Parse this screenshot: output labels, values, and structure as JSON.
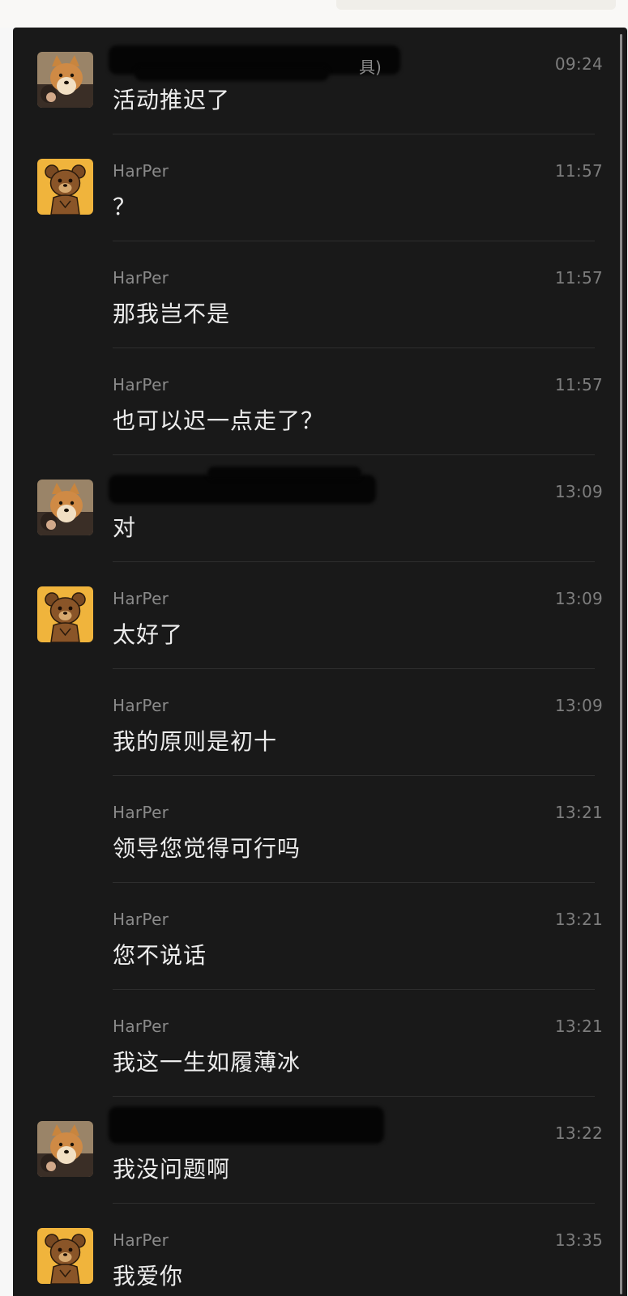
{
  "messages": [
    {
      "sender": "",
      "time": "09:24",
      "text": "活动推迟了",
      "avatar": "shiba-avatar-icon"
    },
    {
      "sender": "HarPer",
      "time": "11:57",
      "text": "？",
      "avatar": "bear-avatar-icon"
    },
    {
      "sender": "HarPer",
      "time": "11:57",
      "text": "那我岂不是",
      "avatar": ""
    },
    {
      "sender": "HarPer",
      "time": "11:57",
      "text": "也可以迟一点走了？",
      "avatar": ""
    },
    {
      "sender": "",
      "time": "13:09",
      "text": "对",
      "avatar": "shiba-avatar-icon"
    },
    {
      "sender": "HarPer",
      "time": "13:09",
      "text": "太好了",
      "avatar": "bear-avatar-icon"
    },
    {
      "sender": "HarPer",
      "time": "13:09",
      "text": "我的原则是初十",
      "avatar": ""
    },
    {
      "sender": "HarPer",
      "time": "13:21",
      "text": "领导您觉得可行吗",
      "avatar": ""
    },
    {
      "sender": "HarPer",
      "time": "13:21",
      "text": "您不说话",
      "avatar": ""
    },
    {
      "sender": "HarPer",
      "time": "13:21",
      "text": "我这一生如履薄冰",
      "avatar": ""
    },
    {
      "sender": "",
      "time": "13:22",
      "text": "我没问题啊",
      "avatar": "shiba-avatar-icon"
    },
    {
      "sender": "HarPer",
      "time": "13:35",
      "text": "我爱你",
      "avatar": "bear-avatar-icon"
    }
  ],
  "redacted_sender_tail": "具)",
  "colors": {
    "panel_bg": "#191919",
    "text": "#ececec",
    "meta": "#8a8a8a",
    "bear_gold": "#f0b43c"
  }
}
